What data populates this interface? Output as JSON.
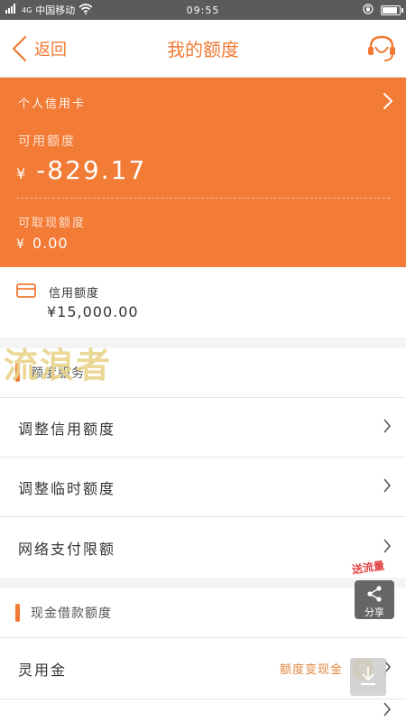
{
  "status_bar": {
    "carrier": "中国移动",
    "signal": "4G",
    "time": "09:55"
  },
  "nav": {
    "back_label": "返回",
    "title": "我的额度"
  },
  "card": {
    "type_label": "个人信用卡",
    "available_label": "可用额度",
    "available_currency": "¥",
    "available_amount": "-829.17",
    "cash_label": "可取现额度",
    "cash_currency": "¥",
    "cash_amount": "0.00"
  },
  "credit": {
    "label": "信用额度",
    "amount": "¥15,000.00"
  },
  "watermark": "流浪者",
  "services": {
    "header": "额度服务",
    "items": [
      {
        "label": "调整信用额度"
      },
      {
        "label": "调整临时额度"
      },
      {
        "label": "网络支付限额"
      }
    ]
  },
  "cash_loan": {
    "header": "现金借款额度",
    "items": [
      {
        "label": "灵用金",
        "sub": "额度变现金"
      }
    ]
  },
  "floating": {
    "promo": "送流量",
    "share_label": "分享"
  },
  "colors": {
    "accent": "#f27b36",
    "orange_text": "#f07a33"
  }
}
